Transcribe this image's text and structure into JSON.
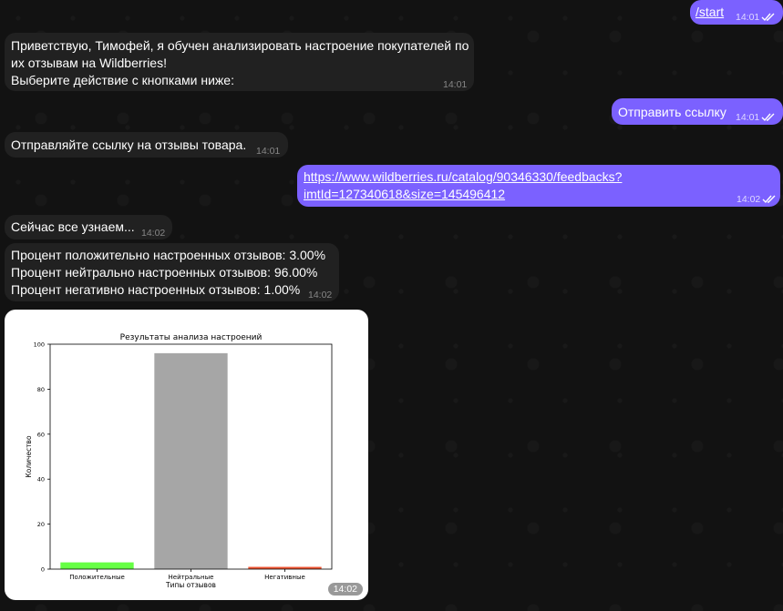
{
  "messages": {
    "start": {
      "text": "/start",
      "time": "14:01"
    },
    "greeting": {
      "lines": [
        "Приветствую, Тимофей, я обучен анализировать настроение покупателей по",
        "их отзывам на Wildberries!",
        "Выберите действие с кнопками ниже:"
      ],
      "time": "14:01"
    },
    "send_link": {
      "text": "Отправить ссылку",
      "time": "14:01"
    },
    "send_prompt": {
      "text": "Отправляйте ссылку на отзывы товара.",
      "time": "14:01"
    },
    "url": {
      "line1": "https://www.wildberries.ru/catalog/90346330/feedbacks?",
      "line2": "imtId=127340618&size=145496412",
      "time": "14:02"
    },
    "wait": {
      "text": "Сейчас все узнаем...",
      "time": "14:02"
    },
    "results": {
      "lines": [
        "Процент положительно настроенных отзывов: 3.00%",
        "Процент нейтрально настроенных отзывов: 96.00%",
        "Процент негативно настроенных отзывов: 1.00%"
      ],
      "time": "14:02"
    },
    "chart_photo": {
      "time": "14:02"
    }
  },
  "chart_data": {
    "type": "bar",
    "title": "Результаты анализа настроений",
    "xlabel": "Типы отзывов",
    "ylabel": "Количество",
    "categories": [
      "Положительные",
      "Нейтральные",
      "Негативные"
    ],
    "values": [
      3,
      96,
      1
    ],
    "colors": [
      "#66ff44",
      "#a6a6a6",
      "#ee5533"
    ],
    "ylim": [
      0,
      100
    ],
    "yticks": [
      0,
      20,
      40,
      60,
      80,
      100
    ],
    "grid": false
  },
  "colors": {
    "incoming_bubble": "#212121",
    "outgoing_bubble": "#7b61ff",
    "background": "#121212"
  }
}
